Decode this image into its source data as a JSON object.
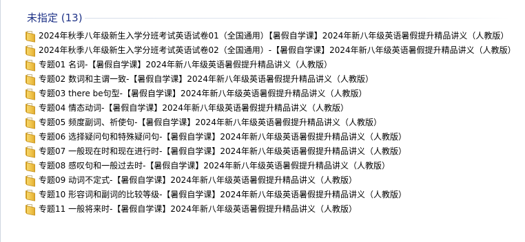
{
  "group": {
    "title": "未指定 (13)"
  },
  "items": [
    {
      "name": "2024年秋季八年级新生入学分班考试英语试卷01（全国通用）【暑假自学课】2024年新八年级英语暑假提升精品讲义（人教版）",
      "icon": "folder-icon"
    },
    {
      "name": "2024年秋季八年级新生入学分班考试英语试卷02（全国通用）-【暑假自学课】2024年新八年级英语暑假提升精品讲义（人教版）",
      "icon": "folder-icon"
    },
    {
      "name": "专题01 名词-【暑假自学课】2024年新八年级英语暑假提升精品讲义（人教版）",
      "icon": "folder-icon"
    },
    {
      "name": "专题02 数词和主谓一致-【暑假自学课】2024年新八年级英语暑假提升精品讲义（人教版）",
      "icon": "folder-icon"
    },
    {
      "name": "专题03 there be句型-【暑假自学课】2024年新八年级英语暑假提升精品讲义（人教版）",
      "icon": "folder-icon"
    },
    {
      "name": "专题04 情态动词-【暑假自学课】2024年新八年级英语暑假提升精品讲义（人教版）",
      "icon": "folder-icon"
    },
    {
      "name": "专题05 频度副词、祈使句-【暑假自学课】2024年新八年级英语暑假提升精品讲义（人教版）",
      "icon": "folder-icon"
    },
    {
      "name": "专题06 选择疑问句和特殊疑问句-【暑假自学课】2024年新八年级英语暑假提升精品讲义（人教版）",
      "icon": "folder-icon"
    },
    {
      "name": "专题07 一般现在时和现在进行时-【暑假自学课】2024年新八年级英语暑假提升精品讲义（人教版）",
      "icon": "folder-icon"
    },
    {
      "name": "专题08 感叹句和一般过去时-【暑假自学课】2024年新八年级英语暑假提升精品讲义（人教版）",
      "icon": "folder-icon"
    },
    {
      "name": "专题09 动词不定式-【暑假自学课】2024年新八年级英语暑假提升精品讲义（人教版）",
      "icon": "folder-icon"
    },
    {
      "name": "专题10 形容词和副词的比较等级-【暑假自学课】2024年新八年级英语暑假提升精品讲义（人教版）",
      "icon": "folder-icon"
    },
    {
      "name": "专题11 一般将来时-【暑假自学课】2024年新八年级英语暑假提升精品讲义（人教版）",
      "icon": "folder-icon"
    }
  ],
  "colors": {
    "group_title": "#1e3287",
    "folder": "#efc34a"
  }
}
